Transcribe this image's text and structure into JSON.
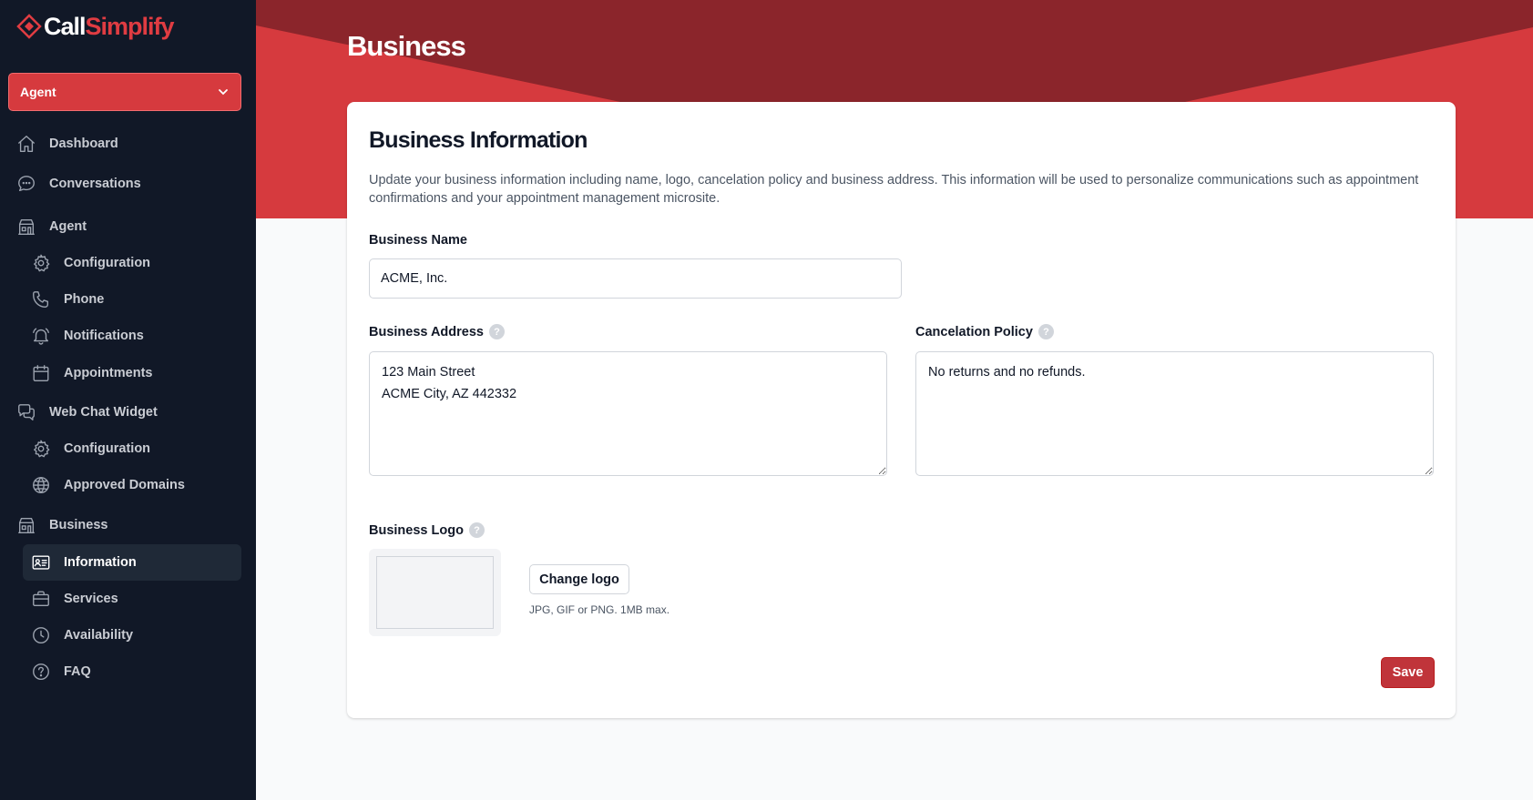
{
  "app": {
    "brand_part1": "Call",
    "brand_part2": "Simplify",
    "brand_color": "#e03c42"
  },
  "sidebar": {
    "agent_select": {
      "value": "Agent",
      "icon": "chevron-down-icon"
    },
    "items": [
      {
        "label": "Dashboard",
        "icon": "home-icon"
      },
      {
        "label": "Conversations",
        "icon": "chat-bubble-icon"
      },
      {
        "label": "Agent",
        "icon": "building-icon"
      },
      {
        "label": "Configuration",
        "icon": "gear-icon"
      },
      {
        "label": "Phone",
        "icon": "phone-icon"
      },
      {
        "label": "Notifications",
        "icon": "bell-icon"
      },
      {
        "label": "Appointments",
        "icon": "calendar-icon"
      },
      {
        "label": "Web Chat Widget",
        "icon": "chat-bubbles-icon"
      },
      {
        "label": "Configuration",
        "icon": "gear-icon"
      },
      {
        "label": "Approved Domains",
        "icon": "globe-icon"
      },
      {
        "label": "Business",
        "icon": "building-icon"
      },
      {
        "label": "Information",
        "icon": "id-card-icon",
        "active": true
      },
      {
        "label": "Services",
        "icon": "briefcase-icon"
      },
      {
        "label": "Availability",
        "icon": "clock-icon"
      },
      {
        "label": "FAQ",
        "icon": "question-circle-icon"
      }
    ]
  },
  "header": {
    "title": "Business",
    "banner_color": "#8b252b",
    "accent_color": "#d63a3e"
  },
  "card": {
    "title": "Business Information",
    "description": "Update your business information including name, logo, cancelation policy and business address. This information will be used to personalize communications such as appointment confirmations and your appointment management microsite.",
    "business_name": {
      "label": "Business Name",
      "value": "ACME, Inc."
    },
    "business_address": {
      "label": "Business Address",
      "value": "123 Main Street\nACME City, AZ 442332",
      "help_glyph": "?"
    },
    "cancelation_policy": {
      "label": "Cancelation Policy",
      "value": "No returns and no refunds.",
      "help_glyph": "?"
    },
    "business_logo": {
      "label": "Business Logo",
      "help_glyph": "?",
      "change_button": "Change logo",
      "hint": "JPG, GIF or PNG. 1MB max."
    },
    "save_button": "Save",
    "save_color": "#c0343a"
  }
}
